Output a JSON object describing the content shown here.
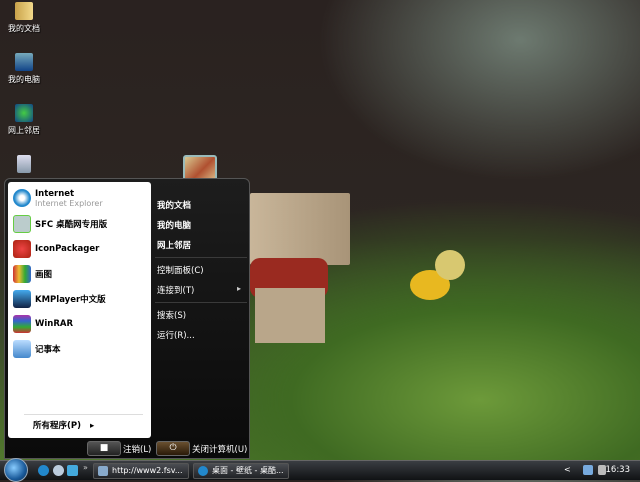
{
  "desktop": {
    "icons": [
      {
        "label": "我的文档",
        "icon": "folder-icon"
      },
      {
        "label": "我的电脑",
        "icon": "computer-icon"
      },
      {
        "label": "网上邻居",
        "icon": "network-icon"
      },
      {
        "label": "",
        "icon": "recycle-bin-icon"
      }
    ]
  },
  "start_menu": {
    "pinned": [
      {
        "label": "Internet",
        "sublabel": "Internet Explorer",
        "icon": "ie-icon"
      }
    ],
    "programs": [
      {
        "label": "SFC 桌酷网专用版",
        "icon": "sfc-icon"
      },
      {
        "label": "IconPackager",
        "icon": "iconpackager-icon"
      },
      {
        "label": "画图",
        "icon": "paint-icon"
      },
      {
        "label": "KMPlayer中文版",
        "icon": "kmplayer-icon"
      },
      {
        "label": "WinRAR",
        "icon": "winrar-icon"
      },
      {
        "label": "记事本",
        "icon": "notepad-icon"
      }
    ],
    "all_programs": "所有程序(P)",
    "right": [
      "我的文档",
      "我的电脑",
      "网上邻居",
      "控制面板(C)",
      "连接到(T)",
      "搜索(S)",
      "运行(R)..."
    ],
    "logoff": "注销(L)",
    "shutdown": "关闭计算机(U)"
  },
  "taskbar": {
    "more": "»",
    "tasks": [
      "http://www2.fsv...",
      "桌面 - 壁纸 - 桌酷..."
    ],
    "tray_expand": "<",
    "clock": "16:33"
  }
}
